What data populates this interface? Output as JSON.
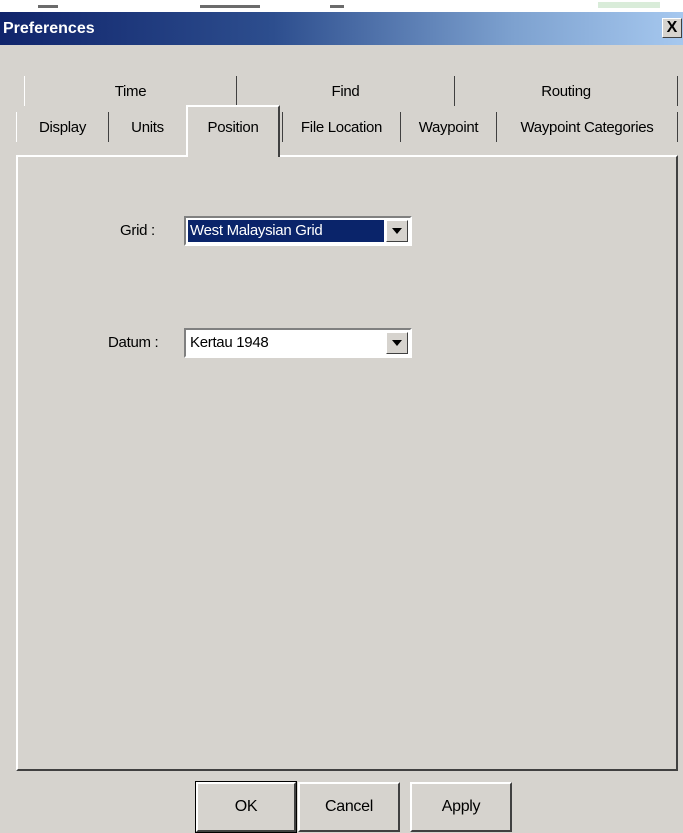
{
  "window": {
    "title": "Preferences",
    "close_label": "X"
  },
  "tabs": {
    "back_row": [
      "Time",
      "Find",
      "Routing"
    ],
    "front_row": [
      "Display",
      "Units",
      "Position",
      "File Location",
      "Waypoint",
      "Waypoint Categories"
    ],
    "active": "Position"
  },
  "position": {
    "grid": {
      "label": "Grid :",
      "value": "West Malaysian Grid"
    },
    "datum": {
      "label": "Datum :",
      "value": "Kertau 1948"
    }
  },
  "buttons": {
    "ok": "OK",
    "cancel": "Cancel",
    "apply": "Apply"
  },
  "colors": {
    "title_start": "#10246b",
    "title_end": "#a6c8ef",
    "face": "#d6d3ce",
    "selection": "#0a246a"
  }
}
